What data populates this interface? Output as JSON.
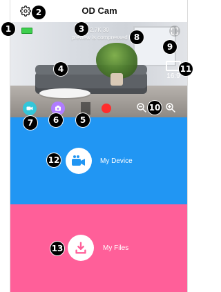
{
  "app": {
    "title": "OD Cam"
  },
  "video": {
    "resolution": "2.7K 30",
    "preview_note": "preview is compressed",
    "aspect_label": "16:9"
  },
  "sections": [
    {
      "label": "My Device"
    },
    {
      "label": "My Files"
    }
  ],
  "callouts": [
    "1",
    "2",
    "3",
    "4",
    "5",
    "6",
    "7",
    "8",
    "9",
    "10",
    "11",
    "12",
    "13"
  ],
  "colors": {
    "device": "#2196f3",
    "files": "#ff5f99",
    "battery": "#3ecf4e",
    "record": "#ff2d2d",
    "video_btn": "#33c6d9",
    "photo_btn": "#b07cff"
  },
  "icons": [
    "gear-icon",
    "battery-icon",
    "fullscreen-icon",
    "aspect-ratio-icon",
    "video-mode-icon",
    "photo-mode-icon",
    "record-icon",
    "zoom-out-icon",
    "zoom-in-icon",
    "camcorder-icon",
    "download-icon"
  ]
}
